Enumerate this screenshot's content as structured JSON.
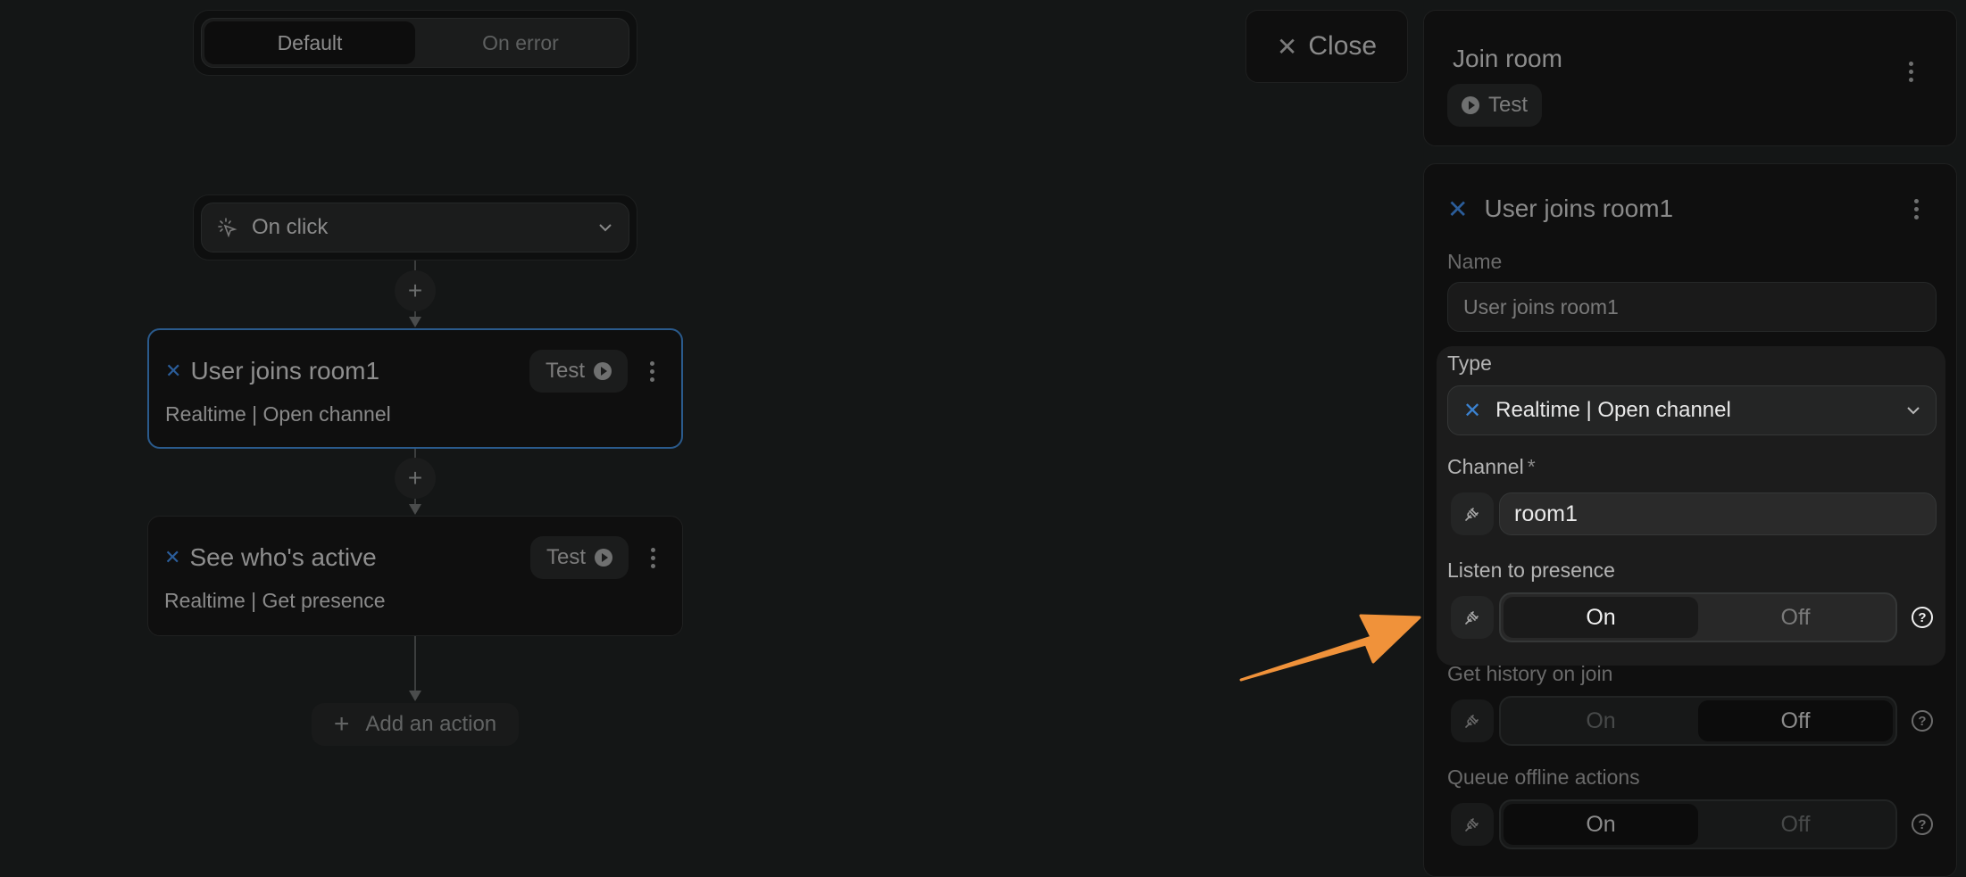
{
  "canvas": {
    "branch_tabs": [
      {
        "label": "Default",
        "active": true
      },
      {
        "label": "On error",
        "active": false
      }
    ],
    "trigger": {
      "label": "On click",
      "icon": "cursor-click-icon"
    },
    "actions": [
      {
        "title": "User joins room1",
        "subtitle": "Realtime | Open channel",
        "test_label": "Test",
        "selected": true
      },
      {
        "title": "See who's active",
        "subtitle": "Realtime | Get presence",
        "test_label": "Test",
        "selected": false
      }
    ],
    "add_action_label": "Add an action"
  },
  "panel": {
    "close_label": "Close",
    "workflow": {
      "title": "Join room",
      "test_label": "Test"
    },
    "action": {
      "title": "User joins room1",
      "name_label": "Name",
      "name_value": "User joins room1",
      "type_label": "Type",
      "type_value": "Realtime | Open channel",
      "channel_label": "Channel",
      "channel_required": "*",
      "channel_value": "room1",
      "listen_presence": {
        "label": "Listen to presence",
        "on": "On",
        "off": "Off",
        "value": "On"
      },
      "history_on_join": {
        "label": "Get history on join",
        "on": "On",
        "off": "Off",
        "value": "Off"
      },
      "queue_offline": {
        "label": "Queue offline actions",
        "on": "On",
        "off": "Off",
        "value": "On"
      }
    }
  },
  "colors": {
    "accent_blue": "#2b5d9a",
    "annotation_arrow": "#f0923a"
  }
}
